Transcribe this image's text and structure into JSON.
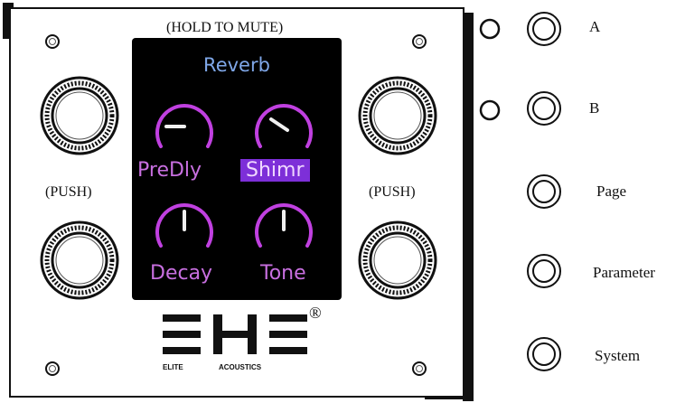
{
  "panel": {
    "hold_label": "(HOLD TO MUTE)",
    "push_left": "(PUSH)",
    "push_right": "(PUSH)",
    "logo_word_left": "ELITE",
    "logo_word_right": "ACOUSTICS",
    "registered": "®"
  },
  "screen": {
    "title": "Reverb",
    "params": [
      {
        "label": "PreDly",
        "selected": false
      },
      {
        "label": "Shimr",
        "selected": true
      },
      {
        "label": "Decay",
        "selected": false
      },
      {
        "label": "Tone",
        "selected": false
      }
    ]
  },
  "buttons": {
    "a": "A",
    "b": "B",
    "page": "Page",
    "parameter": "Parameter",
    "system": "System"
  },
  "colors": {
    "screen_bg": "#000000",
    "title": "#7fa7e8",
    "param": "#c86fe0",
    "selected_bg": "#7d2fd8",
    "dial_arc": "#c040e0"
  }
}
